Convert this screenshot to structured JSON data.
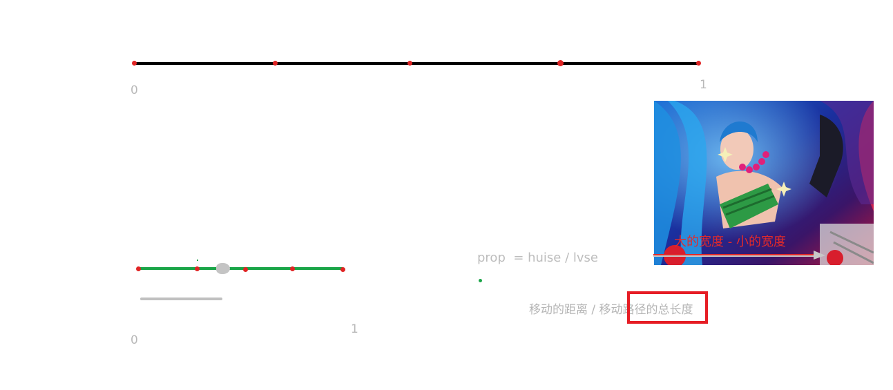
{
  "top_scale": {
    "start_label": "0",
    "end_label": "1",
    "line_color": "#000000",
    "dot_color": "#e02424"
  },
  "bottom_scale": {
    "start_label": "0",
    "end_label": "1",
    "line_color": "#1aa548",
    "track_color": "#c0c0c0"
  },
  "formula": {
    "ratio_text": "prop  = huise / lvse",
    "distance_text": "移动的距离 / 移动路径的总长度"
  },
  "image": {
    "overlay_text": "大的宽度 - 小的宽度",
    "overlay_color": "#e22a2a"
  },
  "highlight": {
    "color": "#e61d25"
  }
}
